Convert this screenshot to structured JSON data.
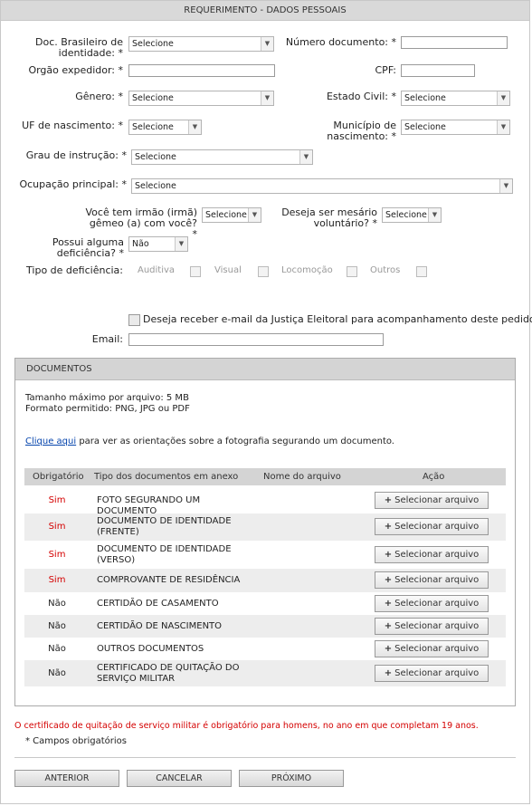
{
  "header": {
    "title": "REQUERIMENTO - DADOS PESSOAIS"
  },
  "form": {
    "doc_label": "Doc. Brasileiro de identidade: *",
    "doc_value": "Selecione",
    "numero_label": "Número documento: *",
    "orgao_label": "Orgão expedidor: *",
    "cpf_label": "CPF:",
    "genero_label": "Gênero: *",
    "genero_value": "Selecione",
    "estado_civil_label": "Estado Civil: *",
    "estado_civil_value": "Selecione",
    "uf_label": "UF de nascimento: *",
    "uf_value": "Selecione",
    "municipio_label": "Município de nascimento: *",
    "municipio_value": "Selecione",
    "grau_label": "Grau de instrução: *",
    "grau_value": "Selecione",
    "ocupacao_label": "Ocupação principal: *",
    "ocupacao_value": "Selecione",
    "gemeo_label": "Você tem irmão (irmã) gêmeo (a) com você? *",
    "gemeo_value": "Selecione",
    "mesario_label": "Deseja ser mesário voluntário? *",
    "mesario_value": "Selecione",
    "deficiencia_label": "Possui alguma deficiência? *",
    "deficiencia_value": "Não",
    "tipo_deficiencia_label": "Tipo de deficiência:",
    "deficiencias": [
      "Auditiva",
      "Visual",
      "Locomoção",
      "Outros"
    ],
    "email_opt_label": "Deseja receber e-mail da Justiça Eleitoral para acompanhamento deste pedido?",
    "email_label": "Email:"
  },
  "documentos": {
    "title": "DOCUMENTOS",
    "tamanho": "Tamanho máximo por arquivo: 5 MB",
    "formato": "Formato permitido: PNG, JPG ou PDF",
    "link_text": "Clique aqui",
    "link_rest": " para ver as orientações sobre a fotografia segurando um documento.",
    "columns": [
      "Obrigatório",
      "Tipo dos documentos em anexo",
      "Nome do arquivo",
      "Ação"
    ],
    "button_label": "Selecionar arquivo",
    "rows": [
      {
        "obrigatorio": "Sim",
        "tipo": "FOTO SEGURANDO UM DOCUMENTO"
      },
      {
        "obrigatorio": "Sim",
        "tipo": "DOCUMENTO DE IDENTIDADE (FRENTE)"
      },
      {
        "obrigatorio": "Sim",
        "tipo": "DOCUMENTO DE IDENTIDADE (VERSO)"
      },
      {
        "obrigatorio": "Sim",
        "tipo": "COMPROVANTE DE RESIDÊNCIA"
      },
      {
        "obrigatorio": "Não",
        "tipo": "CERTIDÃO DE CASAMENTO"
      },
      {
        "obrigatorio": "Não",
        "tipo": "CERTIDÃO DE NASCIMENTO"
      },
      {
        "obrigatorio": "Não",
        "tipo": "OUTROS DOCUMENTOS"
      },
      {
        "obrigatorio": "Não",
        "tipo": "CERTIFICADO DE QUITAÇÃO DO SERVIÇO MILITAR"
      }
    ]
  },
  "notes": {
    "militar": "O certificado de quitação de serviço militar é obrigatório para homens, no ano em que completam 19 anos.",
    "campos": "* Campos obrigatórios"
  },
  "footer": {
    "anterior": "ANTERIOR",
    "cancelar": "CANCELAR",
    "proximo": "PRÓXIMO"
  },
  "colors": {
    "required_red": "#d40000",
    "link_blue": "#0645ad",
    "header_gray": "#d9d9d9"
  }
}
